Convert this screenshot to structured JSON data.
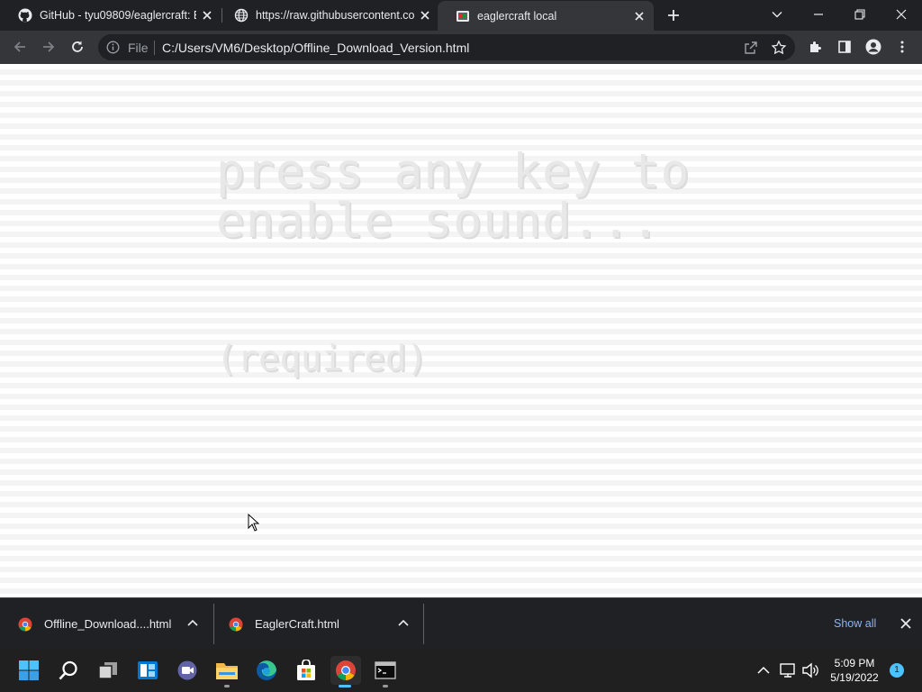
{
  "browser": {
    "tabs": [
      {
        "title": "GitHub - tyu09809/eaglercraft: Ea",
        "favicon": "github-icon",
        "active": false
      },
      {
        "title": "https://raw.githubusercontent.co",
        "favicon": "globe-icon",
        "active": false
      },
      {
        "title": "eaglercraft local",
        "favicon": "eaglercraft-icon",
        "active": true
      }
    ],
    "omnibox": {
      "scheme_label": "File",
      "url": "C:/Users/VM6/Desktop/Offline_Download_Version.html"
    }
  },
  "page": {
    "line1": "press any key to",
    "line2": "enable sound...",
    "line3": "(required)"
  },
  "downloads": {
    "items": [
      {
        "name": "Offline_Download....html"
      },
      {
        "name": "EaglerCraft.html"
      }
    ],
    "show_all_label": "Show all"
  },
  "taskbar": {
    "time": "5:09 PM",
    "date": "5/19/2022",
    "notification_count": "1"
  },
  "colors": {
    "tabstrip_bg": "#202124",
    "toolbar_bg": "#35363a",
    "link_blue": "#8ab4f8",
    "taskbar_bg": "#202020",
    "accent": "#4cc2ff"
  }
}
